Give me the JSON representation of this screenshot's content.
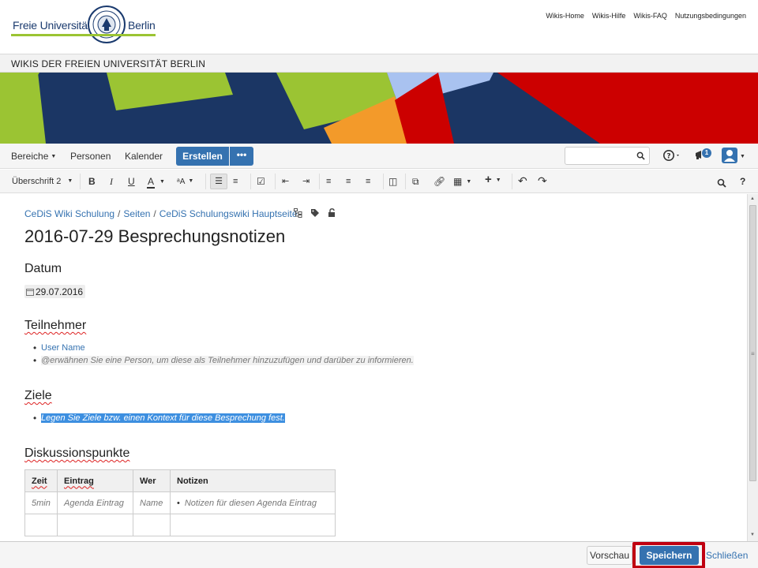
{
  "fu": {
    "logo_left": "Freie Universität",
    "logo_right": "Berlin",
    "top_links": [
      "Wikis-Home",
      "Wikis-Hilfe",
      "Wikis-FAQ",
      "Nutzungsbedingungen"
    ],
    "wiki_title": "WIKIS DER FREIEN UNIVERSITÄT BERLIN"
  },
  "nav": {
    "spaces": "Bereiche",
    "people": "Personen",
    "calendar": "Kalender",
    "create": "Erstellen",
    "more": "•••",
    "search_placeholder": "",
    "notification_count": "1"
  },
  "toolbar": {
    "paragraph_style": "Überschrift 2"
  },
  "breadcrumb": [
    "CeDiS Wiki Schulung",
    "Seiten",
    "CeDiS Schulungswiki Hauptseite"
  ],
  "page": {
    "title": "2016-07-29 Besprechungsnotizen",
    "sections": {
      "date_heading": "Datum",
      "date_value": "29.07.2016",
      "participants_heading": "Teilnehmer",
      "participant_1": "User Name",
      "participant_hint": "@erwähnen Sie eine Person, um diese als Teilnehmer hinzuzufügen und darüber zu informieren.",
      "goals_heading": "Ziele",
      "goals_text": "Legen Sie Ziele bzw. einen Kontext für diese Besprechung fest.",
      "discussion_heading": "Diskussionspunkte"
    },
    "table": {
      "headers": [
        "Zeit",
        "Eintrag",
        "Wer",
        "Notizen"
      ],
      "rows": [
        [
          "5min",
          "Agenda Eintrag",
          "Name",
          "Notizen für diesen Agenda Eintrag"
        ]
      ]
    }
  },
  "footer": {
    "preview": "Vorschau",
    "save": "Speichern",
    "close": "Schließen"
  },
  "colors": {
    "accent": "#3572b0",
    "fu_green": "#9bc433",
    "highlight": "#c00010"
  }
}
